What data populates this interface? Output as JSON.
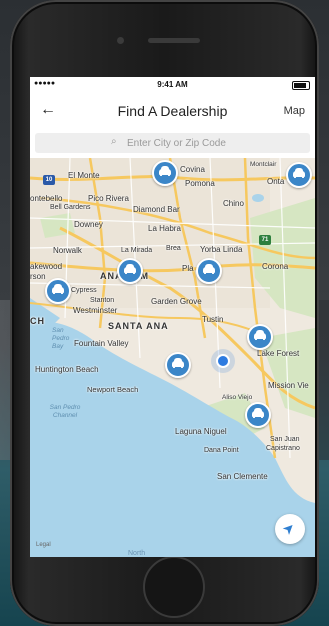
{
  "status": {
    "signal": "●●●●● ",
    "time": "9:41 AM"
  },
  "nav": {
    "back_glyph": "←",
    "title": "Find A Dealership",
    "map_label": "Map"
  },
  "search": {
    "placeholder": "Enter City or Zip Code",
    "icon_glyph": "🔍"
  },
  "map": {
    "places": {
      "covina": "Covina",
      "el_monte": "El Monte",
      "pomona": "Pomona",
      "montclair": "Montclair",
      "ontario": "Onta",
      "montebello": "ontebello",
      "pico_rivera": "Pico Rivera",
      "bell_gardens": "Bell Gardens",
      "diamond_bar": "Diamond Bar",
      "chino": "Chino",
      "downey": "Downey",
      "la_habra": "La Habra",
      "norwalk": "Norwalk",
      "la_mirada": "La Mirada",
      "brea": "Brea",
      "yorba_linda": "Yorba Linda",
      "lakewood": "akewood",
      "cerritos": "rson",
      "anaheim": "ANAHEIM",
      "placentia": "Pla",
      "corona": "Corona",
      "cypress": "Cypress",
      "stanton": "Stanton",
      "westminster": "Westminster",
      "garden_grove": "Garden Grove",
      "tustin": "Tustin",
      "santa_ana": "SANTA ANA",
      "long_beach": "CH",
      "fountain_valley": "Fountain Valley",
      "lake_forest": "Lake Forest",
      "huntington_beach": "Huntington Beach",
      "mission_viejo": "Mission Vie",
      "newport_beach": "Newport Beach",
      "aliso_viejo": "Aliso Viejo",
      "laguna_niguel": "Laguna Niguel",
      "san_juan": "San Juan",
      "capistrano": "Capistrano",
      "dana_point": "Dana Point",
      "san_clemente": "San Clemente",
      "san_pedro_bay": "San Pedro Bay",
      "san_pedro_channel": "San Pedro Channel",
      "north": "North",
      "legal": "Legal"
    },
    "shields": {
      "i10": "10",
      "sr71": "71"
    },
    "dealer_pins": [
      "dealer-covina",
      "dealer-ontario",
      "dealer-anaheim",
      "dealer-yorba-linda",
      "dealer-lakewood",
      "dealer-irvine",
      "dealer-newport",
      "dealer-laguna"
    ],
    "colors": {
      "pin": "#3b86c8",
      "water": "#a9d3ea",
      "land": "#efe9df",
      "park": "#cfe3b8",
      "freeway": "#f6c85f"
    }
  }
}
